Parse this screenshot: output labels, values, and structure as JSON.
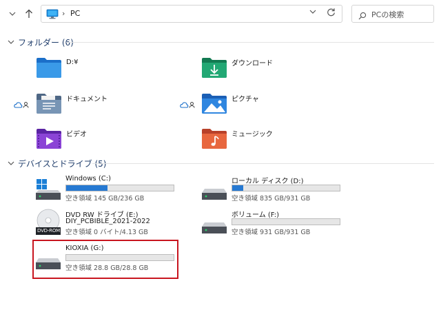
{
  "address_bar": {
    "location_label": "PC",
    "search_placeholder": "PCの検索"
  },
  "folders_section": {
    "title": "フォルダー (6)",
    "items": [
      {
        "label": "D:¥",
        "icon": "folder-icon",
        "color": "#2a7dd6"
      },
      {
        "label": "ダウンロード",
        "icon": "downloads-folder-icon",
        "color": "#1e9e6b"
      },
      {
        "label": "ドキュメント",
        "icon": "documents-folder-icon",
        "color": "#6f8aa7",
        "cloud_status": true
      },
      {
        "label": "ピクチャ",
        "icon": "pictures-folder-icon",
        "color": "#2a7dd6",
        "cloud_status": true
      },
      {
        "label": "ビデオ",
        "icon": "videos-folder-icon",
        "color": "#7e3bc9"
      },
      {
        "label": "ミュージック",
        "icon": "music-folder-icon",
        "color": "#e05a3a"
      }
    ]
  },
  "drives_section": {
    "title": "デバイスとドライブ (5)",
    "items": [
      {
        "name": "Windows (C:)",
        "free_text": "空き領域 145 GB/236 GB",
        "used_fraction": 0.385,
        "icon": "windows-drive-icon"
      },
      {
        "name": "ローカル ディスク (D:)",
        "free_text": "空き領域 835 GB/931 GB",
        "used_fraction": 0.103,
        "icon": "hdd-icon"
      },
      {
        "name": "DVD RW ドライブ (E:)",
        "name2": "DIY_PCBIBLE_2021-2022",
        "free_text": "空き領域 0 バイト/4.13 GB",
        "icon": "dvd-rom-icon",
        "icon_label": "DVD-ROM"
      },
      {
        "name": "ボリューム (F:)",
        "free_text": "空き領域 931 GB/931 GB",
        "used_fraction": 0.0,
        "icon": "hdd-icon"
      },
      {
        "name": "KIOXIA (G:)",
        "free_text": "空き領域 28.8 GB/28.8 GB",
        "used_fraction": 0.0,
        "icon": "hdd-icon"
      }
    ]
  },
  "colors": {
    "accent": "#2679d2",
    "highlight": "#c8141e",
    "section_title": "#1f3d6b"
  }
}
